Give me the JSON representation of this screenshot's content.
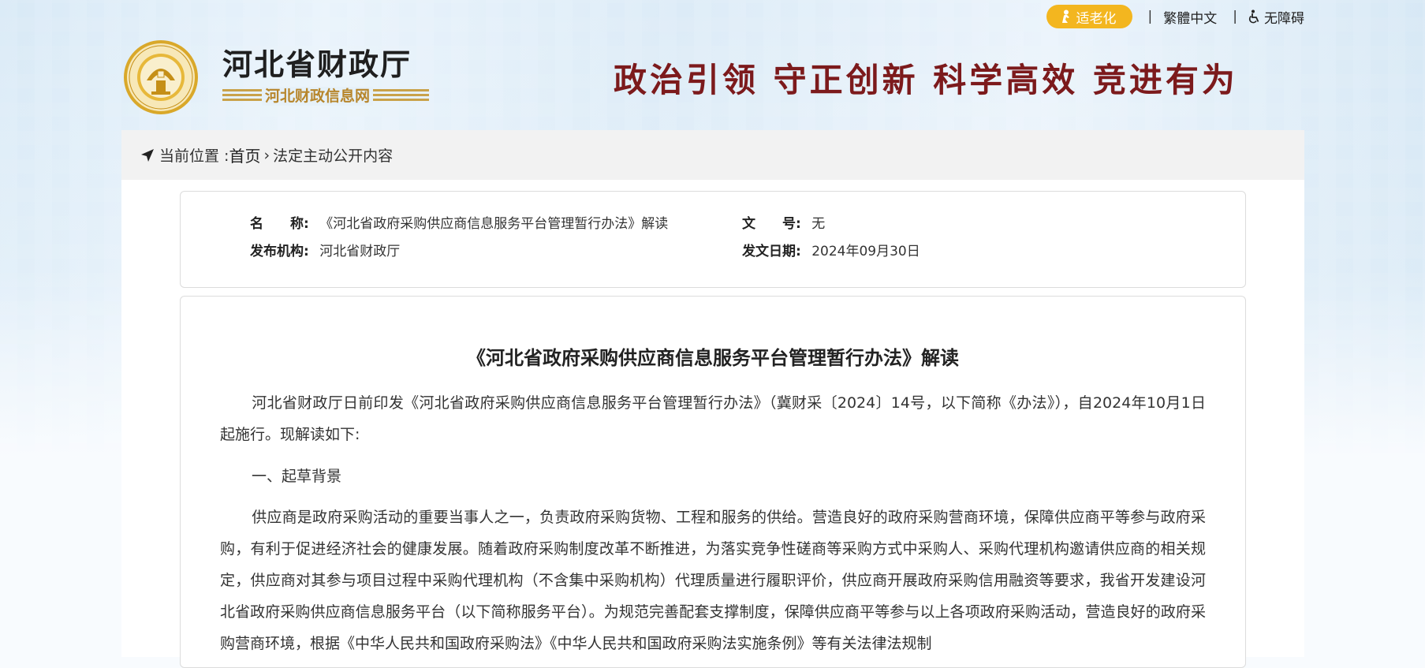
{
  "topbar": {
    "elder_label": "适老化",
    "traditional_label": "繁體中文",
    "a11y_label": "无障碍",
    "separator": "|"
  },
  "logo": {
    "title": "河北省财政厅",
    "subtitle": "河北财政信息网"
  },
  "slogan": "政治引领  守正创新  科学高效  竞进有为",
  "breadcrumb": {
    "prefix": "当前位置 : ",
    "home": "首页",
    "separator": "›",
    "current": "法定主动公开内容"
  },
  "info": {
    "name_key": "名　　称:",
    "name_value": "《河北省政府采购供应商信息服务平台管理暂行办法》解读",
    "doc_no_key": "文　　号:",
    "doc_no_value": "无",
    "issuer_key": "发布机构:",
    "issuer_value": "河北省财政厅",
    "date_key": "发文日期:",
    "date_value": "2024年09月30日"
  },
  "article": {
    "title": "《河北省政府采购供应商信息服务平台管理暂行办法》解读",
    "p1": "河北省财政厅日前印发《河北省政府采购供应商信息服务平台管理暂行办法》（冀财采〔2024〕14号，以下简称《办法》），自2024年10月1日起施行。现解读如下:",
    "heading1": "一、起草背景",
    "p2": "供应商是政府采购活动的重要当事人之一，负责政府采购货物、工程和服务的供给。营造良好的政府采购营商环境，保障供应商平等参与政府采购，有利于促进经济社会的健康发展。随着政府采购制度改革不断推进，为落实竞争性磋商等采购方式中采购人、采购代理机构邀请供应商的相关规定，供应商对其参与项目过程中采购代理机构（不含集中采购机构）代理质量进行履职评价，供应商开展政府采购信用融资等要求，我省开发建设河北省政府采购供应商信息服务平台（以下简称服务平台）。为规范完善配套支撑制度，保障供应商平等参与以上各项政府采购活动，营造良好的政府采购营商环境，根据《中华人民共和国政府采购法》《中华人民共和国政府采购法实施条例》等有关法律法规制"
  },
  "colors": {
    "elder_button": "#f3b61f",
    "slogan": "#7c1a1c",
    "logo_gold": "#c9a24a"
  }
}
